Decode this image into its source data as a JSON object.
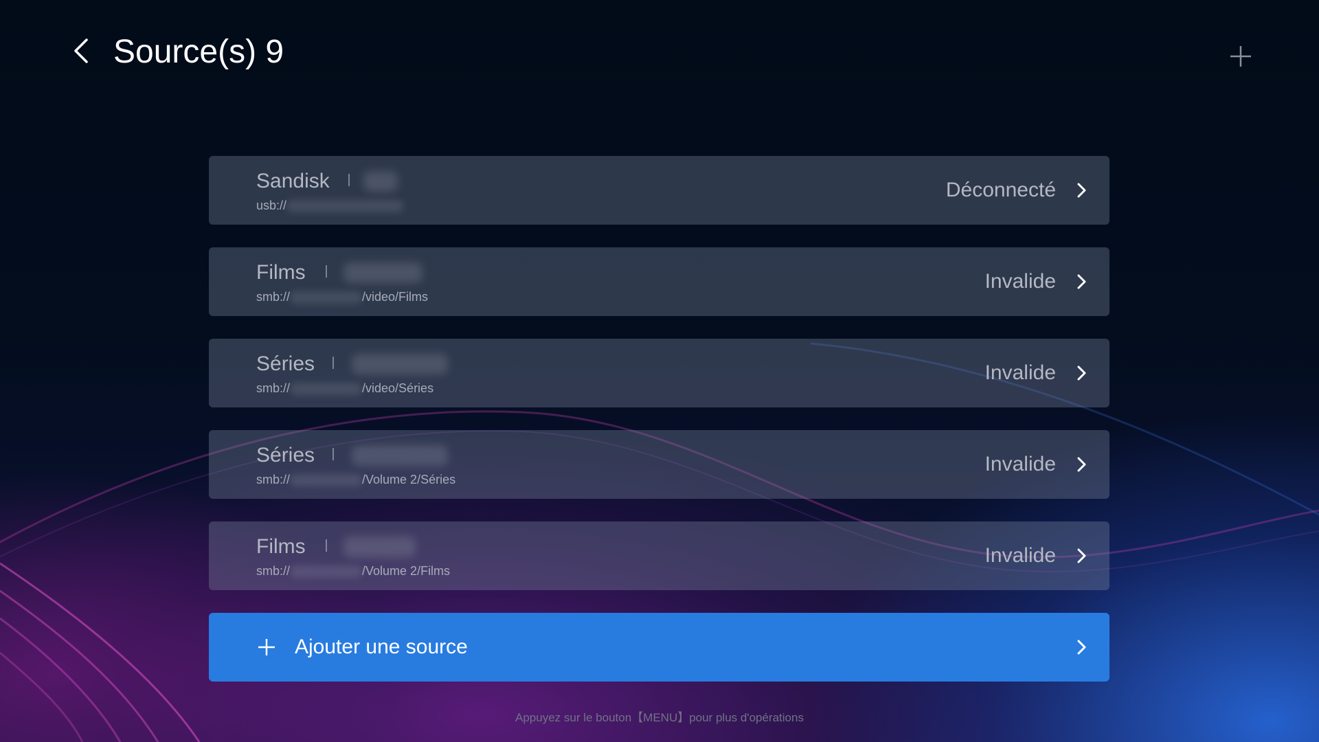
{
  "header": {
    "title": "Source(s) 9"
  },
  "sources": [
    {
      "name": "Sandisk",
      "path_prefix": "usb://",
      "path_suffix": "",
      "status": "Déconnecté"
    },
    {
      "name": "Films",
      "path_prefix": "smb://",
      "path_suffix": "/video/Films",
      "status": "Invalide"
    },
    {
      "name": "Séries",
      "path_prefix": "smb://",
      "path_suffix": "/video/Séries",
      "status": "Invalide"
    },
    {
      "name": "Séries",
      "path_prefix": "smb://",
      "path_suffix": "/Volume 2/Séries",
      "status": "Invalide"
    },
    {
      "name": "Films",
      "path_prefix": "smb://",
      "path_suffix": "/Volume 2/Films",
      "status": "Invalide"
    }
  ],
  "add_source": {
    "label": "Ajouter une source"
  },
  "footer": {
    "hint": "Appuyez sur le bouton【MENU】pour plus d'opérations"
  },
  "colors": {
    "accent": "#287ce0",
    "background": "#020a18",
    "item_background": "#3a4452"
  },
  "icons": {
    "back": "chevron-left-icon",
    "add": "plus-icon",
    "item_arrow": "chevron-right-icon"
  }
}
